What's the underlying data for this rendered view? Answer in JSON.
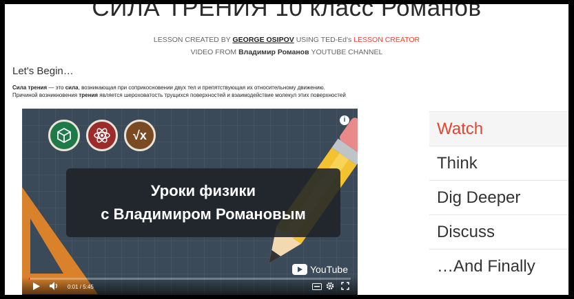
{
  "title": "СИЛА ТРЕНИЯ 10 класс Романов",
  "credits": {
    "line1_prefix": "LESSON CREATED BY",
    "author": "GEORGE OSIPOV",
    "line1_mid": "USING TED-Ed's",
    "creator_link": "LESSON CREATOR",
    "line2_prefix": "VIDEO FROM",
    "channel": "Владимир Романов",
    "line2_suffix": "YOUTUBE CHANNEL"
  },
  "intro": {
    "heading": "Let's Begin…",
    "term": "Сила трения",
    "text1": " — это ",
    "term2": "сила",
    "text2": ", возникающая при соприкосновении двух тел и препятствующая их относительному движению.",
    "text3": "Причиной возникновения ",
    "term3": "трения",
    "text4": " является шероховатость трущихся поверхностей и взаимодействие молекул этих поверхностей"
  },
  "video": {
    "banner_line1": "Уроки физики",
    "banner_line2": "с Владимиром Романовым",
    "youtube_label": "YouTube",
    "time": "0:01 / 5:45",
    "progress_percent": 0.3,
    "info_label": "i"
  },
  "tabs": [
    {
      "label": "Watch",
      "active": true
    },
    {
      "label": "Think",
      "active": false
    },
    {
      "label": "Dig Deeper",
      "active": false
    },
    {
      "label": "Discuss",
      "active": false
    },
    {
      "label": "…And Finally",
      "active": false
    }
  ],
  "colors": {
    "accent": "#e8442b"
  }
}
